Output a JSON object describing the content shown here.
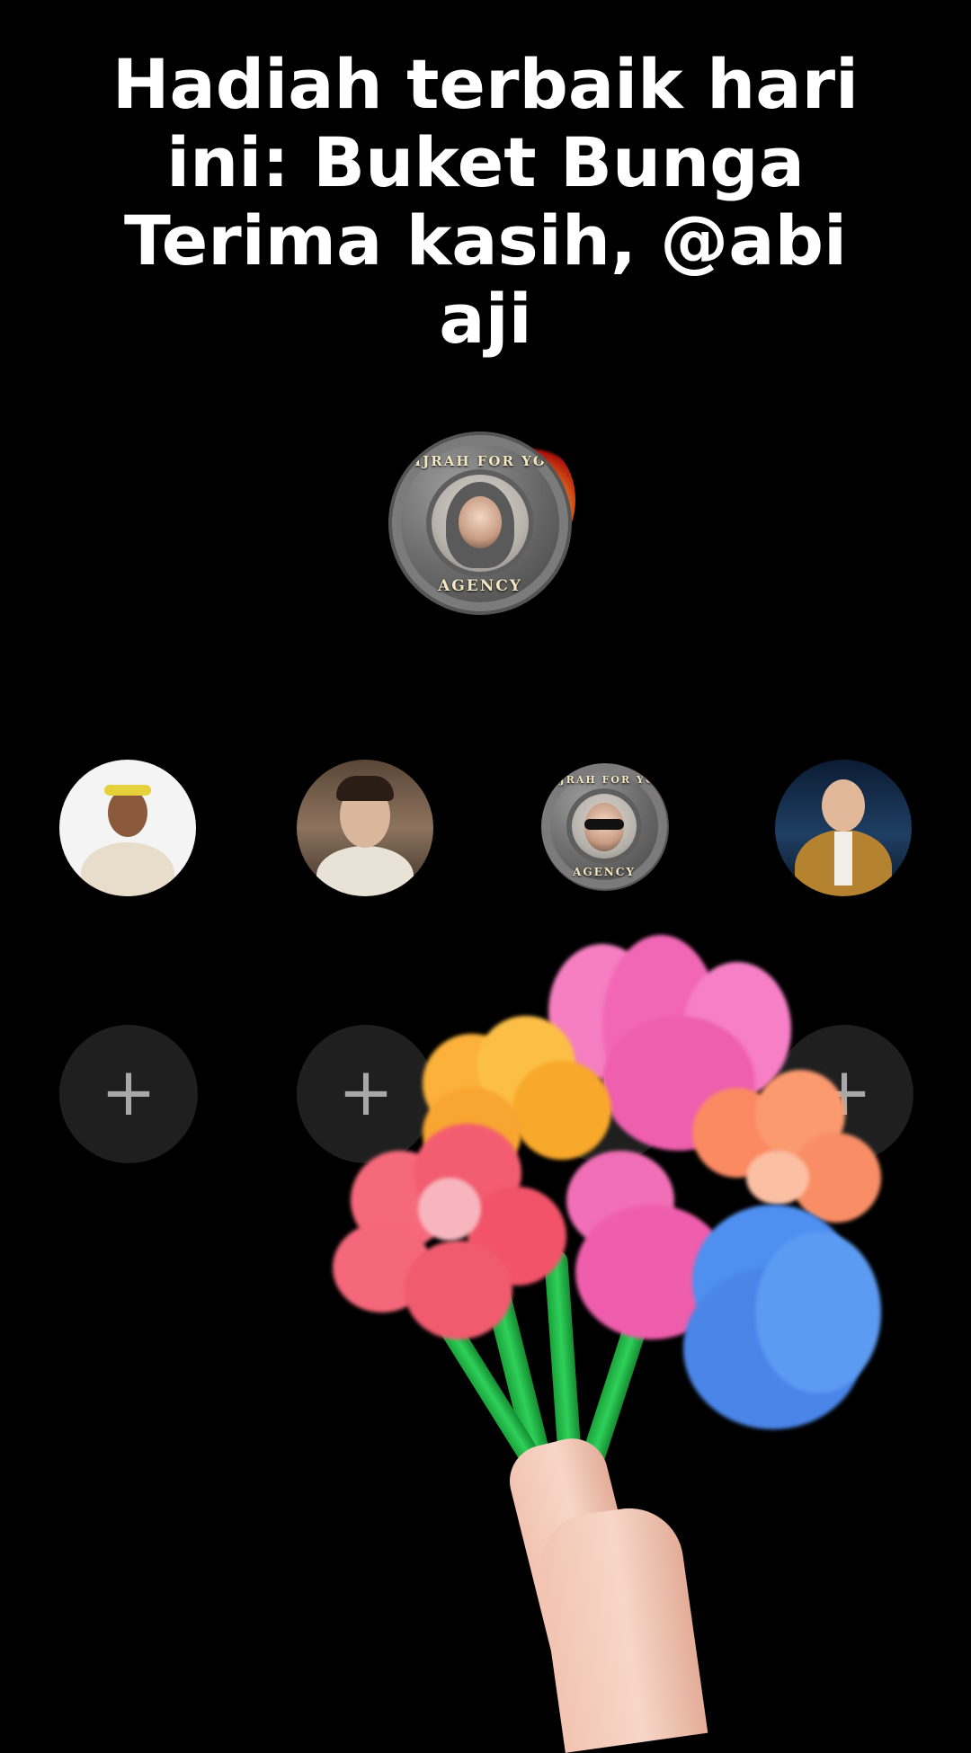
{
  "announcement": {
    "lines": [
      "Hadiah terbaik hari",
      "ini: Buket Bunga",
      "Terima kasih, @abi",
      "aji"
    ]
  },
  "host_badge": {
    "ring_top_text": "HIJRAH FOR YOU",
    "ring_bottom_text": "AGENCY"
  },
  "guest_row": {
    "avatars": [
      {
        "name": "guest-avatar-1"
      },
      {
        "name": "guest-avatar-2"
      },
      {
        "name": "guest-avatar-3",
        "ring_top_text": "HIJRAH FOR YOU",
        "ring_bottom_text": "AGENCY"
      },
      {
        "name": "guest-avatar-4"
      }
    ]
  },
  "empty_slots": {
    "labels": [
      "+",
      "+",
      "+",
      "+"
    ]
  },
  "colors": {
    "background": "#000000",
    "slot_background": "#1f1f1f",
    "plus_color": "#a8a8a8",
    "title_text": "#ffffff"
  },
  "icons": {
    "add_slot": "plus-icon",
    "gift": "flower-bouquet-icon"
  }
}
